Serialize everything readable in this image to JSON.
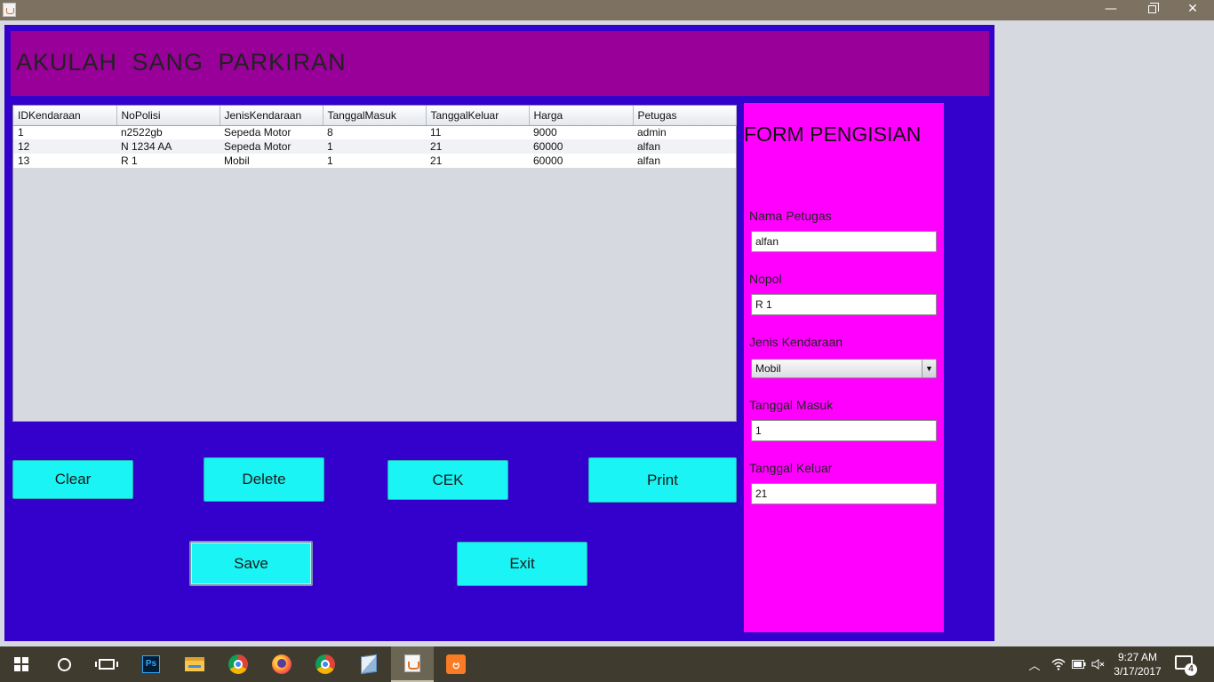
{
  "window": {
    "minimize_glyph": "—",
    "close_glyph": "✕"
  },
  "header": {
    "title": "AKULAH  SANG  PARKIRAN"
  },
  "table": {
    "columns": [
      "IDKendaraan",
      "NoPolisi",
      "JenisKendaraan",
      "TanggalMasuk",
      "TanggalKeluar",
      "Harga",
      "Petugas"
    ],
    "rows": [
      [
        "1",
        "n2522gb",
        "Sepeda Motor",
        "8",
        "11",
        "9000",
        "admin"
      ],
      [
        "12",
        "N 1234 AA",
        "Sepeda Motor",
        "1",
        "21",
        "60000",
        "alfan"
      ],
      [
        "13",
        "R 1",
        "Mobil",
        "1",
        "21",
        "60000",
        "alfan"
      ]
    ]
  },
  "buttons": {
    "clear": "Clear",
    "delete": "Delete",
    "cek": "CEK",
    "print": "Print",
    "save": "Save",
    "exit": "Exit"
  },
  "form": {
    "title": "FORM PENGISIAN",
    "nama_petugas_label": "Nama Petugas",
    "nama_petugas_value": "alfan",
    "nopol_label": "Nopol",
    "nopol_value": "R 1",
    "jenis_label": "Jenis Kendaraan",
    "jenis_value": "Mobil",
    "tgl_masuk_label": "Tanggal Masuk",
    "tgl_masuk_value": "1",
    "tgl_keluar_label": "Tanggal Keluar",
    "tgl_keluar_value": "21"
  },
  "taskbar": {
    "ps_label": "Ps",
    "clock_time": "9:27 AM",
    "clock_date": "3/17/2017",
    "notification_count": "4",
    "icons": [
      "windows-start-icon",
      "cortana-search-icon",
      "task-view-icon",
      "photoshop-icon",
      "file-explorer-icon",
      "chrome-icon",
      "firefox-icon",
      "chrome-icon",
      "virtualbox-icon",
      "java-icon",
      "xampp-icon"
    ]
  },
  "colors": {
    "app_background": "#3300cc",
    "header_background": "#990099",
    "form_background": "#ff00ff",
    "button_background": "#1af4f4"
  }
}
